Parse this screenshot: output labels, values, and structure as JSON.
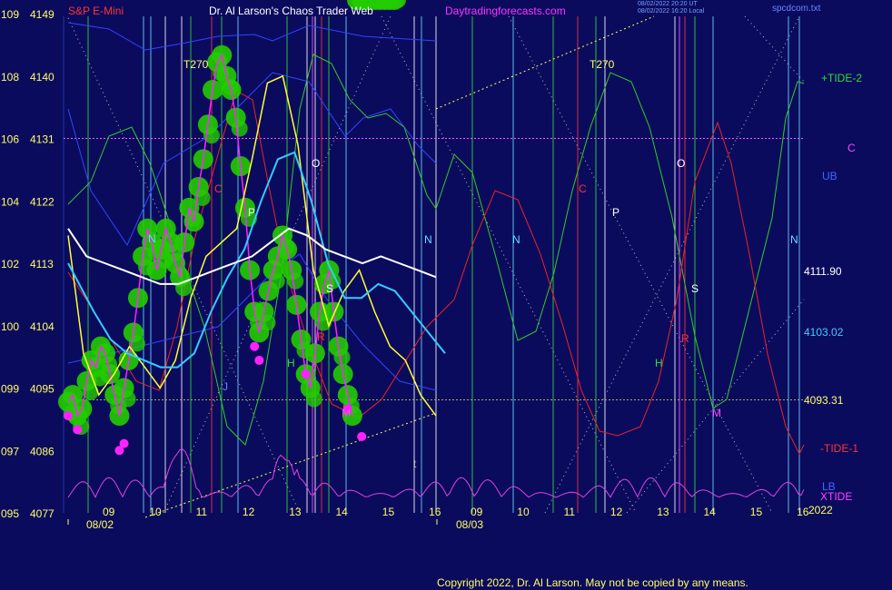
{
  "header": {
    "symbol": "S&P E-Mini",
    "title": "Dr. Al Larson's Chaos Trader Web",
    "site": "Daytradingforecasts.com",
    "timestamp_utc": "08/02/2022 20:20 UT",
    "timestamp_local": "08/02/2022 16:20 Local",
    "file": "spcdcom.txt"
  },
  "copyright": "Copyright 2022, Dr. Al Larson. May not be copied by any means.",
  "colors": {
    "background": "#0b0b5e",
    "price_axis": "#ffff66",
    "green_dots": "#22cc00",
    "magenta_dots": "#ff22ff",
    "white_avg": "#ffffff",
    "cyan_avg": "#33ccff",
    "tide2": "#33cc22",
    "tide1": "#ee2222",
    "xtide": "#dd44dd"
  },
  "chart_data": {
    "type": "line",
    "title": "S&P E-Mini",
    "y_axis": {
      "range": [
        4077,
        4149
      ],
      "ticks": [
        {
          "index": "109",
          "price": "4149"
        },
        {
          "index": "108",
          "price": "4140"
        },
        {
          "index": "106",
          "price": "4131"
        },
        {
          "index": "104",
          "price": "4122"
        },
        {
          "index": "102",
          "price": "4113"
        },
        {
          "index": "100",
          "price": "4104"
        },
        {
          "index": "099",
          "price": "4095"
        },
        {
          "index": "097",
          "price": "4086"
        },
        {
          "index": "095",
          "price": "4077"
        }
      ]
    },
    "x_axis": {
      "hour_labels": [
        "09",
        "10",
        "11",
        "12",
        "13",
        "14",
        "15",
        "16",
        "09",
        "10",
        "11",
        "12",
        "13",
        "14",
        "15",
        "16"
      ],
      "date_labels": [
        "08/02",
        "08/03"
      ],
      "year_label": "2022"
    },
    "right_labels": {
      "tide2": "+TIDE-2",
      "c": "C",
      "ub": "UB",
      "level1": "4111.90",
      "level2": "4103.02",
      "level3": "4093.31",
      "tide1": "-TIDE-1",
      "lb": "LB",
      "xtide": "XTIDE"
    },
    "annotations": [
      "T270",
      "N",
      "C",
      "P",
      "O",
      "S",
      "R",
      "H",
      "M",
      "J",
      "t",
      "T270",
      "C",
      "P",
      "O",
      "S",
      "R",
      "H",
      "M",
      "N",
      "N",
      "N"
    ],
    "series": [
      {
        "name": "price",
        "x_hours": [
          9.0,
          9.1,
          9.2,
          9.3,
          9.4,
          9.5,
          9.6,
          9.7,
          9.8,
          9.9,
          10.0,
          10.1,
          10.2,
          10.3,
          10.4,
          10.5,
          10.6,
          10.7,
          10.8,
          10.9,
          11.0,
          11.1,
          11.2,
          11.3,
          11.4,
          11.5,
          11.6,
          11.7,
          11.8,
          11.9,
          12.0,
          12.1,
          12.2,
          12.3,
          12.4,
          12.5,
          12.6,
          12.7,
          12.8,
          12.9,
          13.0,
          13.1,
          13.2,
          13.3,
          13.4,
          13.5,
          13.6,
          13.7,
          13.8,
          13.9,
          14.0,
          14.1,
          14.2,
          14.3,
          14.4,
          14.5,
          14.6,
          14.7,
          14.8,
          14.9,
          15.0,
          15.1,
          15.2,
          15.3,
          15.4,
          15.5,
          15.6,
          15.7,
          15.8,
          15.9,
          16.0
        ],
        "values": [
          4093,
          4094,
          4091,
          4092,
          4096,
          4099,
          4098,
          4101,
          4100,
          4097,
          4094,
          4091,
          4095,
          4099,
          4103,
          4108,
          4114,
          4118,
          4116,
          4112,
          4115,
          4118,
          4116,
          4113,
          4111,
          4116,
          4121,
          4119,
          4124,
          4128,
          4133,
          4138,
          4142,
          4143,
          4140,
          4138,
          4134,
          4127,
          4121,
          4112,
          4106,
          4103,
          4106,
          4109,
          4112,
          4114,
          4117,
          4115,
          4112,
          4107,
          4102,
          4097,
          4095,
          4100,
          4106,
          4110,
          4112,
          4106,
          4101,
          4097,
          4094,
          4091
        ]
      },
      {
        "name": "yellow",
        "values": [
          4117,
          4100,
          4094,
          4097,
          4101,
          4098,
          4095,
          4099,
          4108,
          4114,
          4116,
          4118,
          4128,
          4139,
          4140,
          4130,
          4112,
          4104,
          4109,
          4112,
          4106,
          4101,
          4099,
          4094,
          4091
        ]
      },
      {
        "name": "cyan",
        "values": [
          4113,
          4106,
          4102,
          4100,
          4099,
          4098,
          4098,
          4100,
          4106,
          4111,
          4115,
          4122,
          4128,
          4129,
          4122,
          4113,
          4108,
          4108,
          4110,
          4109,
          4106,
          4103,
          4100
        ]
      },
      {
        "name": "white",
        "values": [
          4118,
          4114,
          4113,
          4112,
          4111,
          4110,
          4110,
          4111,
          4112,
          4113,
          4114,
          4116,
          4118,
          4117,
          4115,
          4114,
          4113,
          4114,
          4113,
          4112,
          4111
        ]
      }
    ]
  }
}
